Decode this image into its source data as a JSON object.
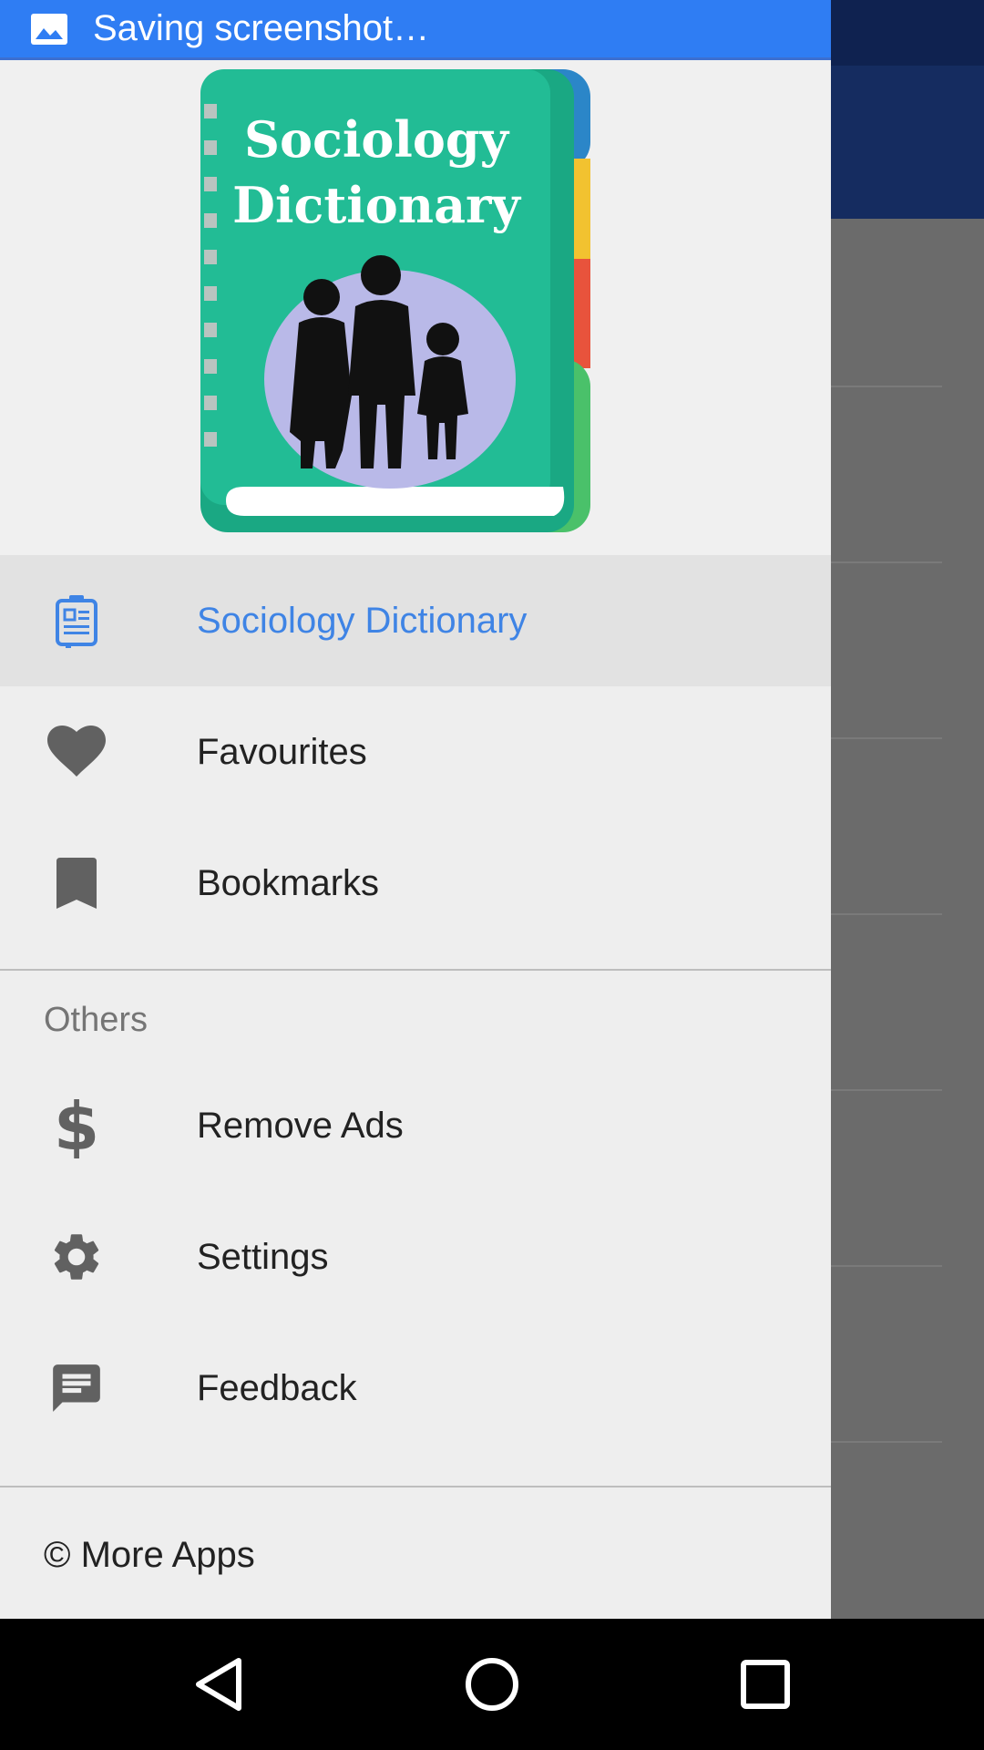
{
  "status_bar": {
    "notification_text": "Saving screenshot…",
    "notification_icon": "image-icon",
    "color": "#2f7df3"
  },
  "drawer": {
    "header": {
      "logo_title_line1": "Sociology",
      "logo_title_line2": "Dictionary"
    },
    "items": [
      {
        "label": "Sociology Dictionary",
        "icon": "dictionary-icon",
        "active": true
      },
      {
        "label": "Favourites",
        "icon": "heart-icon"
      },
      {
        "label": "Bookmarks",
        "icon": "bookmark-icon"
      }
    ],
    "section_title": "Others",
    "other_items": [
      {
        "label": "Remove Ads",
        "icon": "dollar-icon"
      },
      {
        "label": "Settings",
        "icon": "gear-icon"
      },
      {
        "label": "Feedback",
        "icon": "feedback-icon"
      }
    ],
    "footer": "© More Apps"
  },
  "colors": {
    "accent": "#3f84e5",
    "drawer_bg": "#eeeeee",
    "active_bg": "#e2e2e2",
    "toolbar": "#152c60",
    "book_cover": "#1fb893"
  },
  "navigation_bar": {
    "buttons": [
      "back-icon",
      "home-icon",
      "recents-icon"
    ]
  }
}
